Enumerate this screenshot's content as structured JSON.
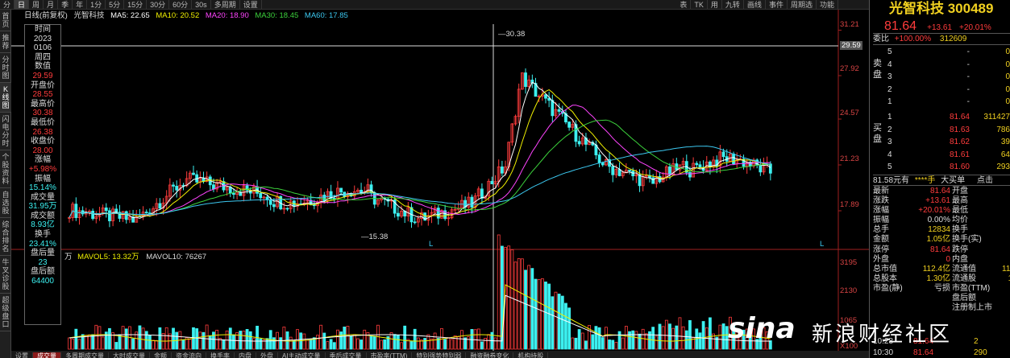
{
  "top_menu": {
    "items": [
      "分",
      "日",
      "周",
      "月",
      "季",
      "年",
      "1分",
      "5分",
      "15分",
      "30分",
      "60分",
      "30s",
      "多周期",
      "设置"
    ],
    "selected_index": 1,
    "right_items": [
      "表",
      "TK",
      "用",
      "九转",
      "画线",
      "事件",
      "周期选",
      "功能"
    ]
  },
  "left_nav": [
    {
      "label": "首页",
      "selected": false
    },
    {
      "label": "推荐",
      "selected": false
    },
    {
      "label": "分时图",
      "selected": false
    },
    {
      "label": "K线图",
      "selected": true
    },
    {
      "label": "闪电分时",
      "selected": false
    },
    {
      "label": "个股资料",
      "selected": false
    },
    {
      "label": "自选股",
      "selected": false
    },
    {
      "label": "综合排名",
      "selected": false
    },
    {
      "label": "牛叉诊股",
      "selected": false
    },
    {
      "label": "超级盘口",
      "selected": false
    }
  ],
  "chart_header": {
    "period": "日线(前复权)",
    "stock": "光智科技",
    "ma5": "MA5: 22.65",
    "ma10": "MA10: 20.52",
    "ma20": "MA20: 18.90",
    "ma30": "MA30: 18.45",
    "ma60": "MA60: 17.85",
    "colors": {
      "ma5": "#ffffff",
      "ma10": "#f0f000",
      "ma20": "#ff44ff",
      "ma30": "#3cd23c",
      "ma60": "#3cc8f0"
    }
  },
  "data_window": {
    "rows": [
      {
        "label": "时间",
        "value": "2023"
      },
      {
        "label": "",
        "value": "0106"
      },
      {
        "label": "周四",
        "value": ""
      },
      {
        "label": "数值",
        "value": "29.59",
        "color": "red"
      },
      {
        "label": "开盘价",
        "value": "28.55",
        "color": "red"
      },
      {
        "label": "最高价",
        "value": "30.38",
        "color": "red"
      },
      {
        "label": "最低价",
        "value": "26.38",
        "color": "red"
      },
      {
        "label": "收盘价",
        "value": "28.00",
        "color": "red"
      },
      {
        "label": "涨幅",
        "value": "+5.98%",
        "color": "red"
      },
      {
        "label": "振幅",
        "value": "15.14%",
        "color": "cyan"
      },
      {
        "label": "成交量",
        "value": "31.95万",
        "color": "cyan"
      },
      {
        "label": "成交额",
        "value": "8.93亿",
        "color": "cyan"
      },
      {
        "label": "换手",
        "value": "23.41%",
        "color": "cyan"
      },
      {
        "label": "盘后量",
        "value": "23",
        "color": "cyan"
      },
      {
        "label": "盘后额",
        "value": "64400",
        "color": "cyan"
      }
    ]
  },
  "price_chart": {
    "price_labels": [
      "31.21",
      "29.59",
      "27.92",
      "24.57",
      "21.23",
      "17.89"
    ],
    "high_marker": "30.38",
    "low_marker": "15.38",
    "l_markers": [
      "L",
      "L"
    ]
  },
  "volume_chart": {
    "unit": "万",
    "mavol5": "MAVOL5: 13.32万",
    "mavol10": "MAVOL10: 76267",
    "labels": [
      "3195",
      "2130",
      "1065",
      "X100"
    ]
  },
  "bottom_tabs": {
    "items": [
      "设置",
      "成交量",
      "多周期成交量",
      "大时成交量",
      "金额",
      "资金流向",
      "换手率",
      "内盘",
      "外盘",
      "AI主动成交量",
      "季后成交量",
      "市盈率(TTM)",
      "特别强势特别弱",
      "融资融券变化",
      "机构持股"
    ],
    "selected_index": 1
  },
  "quote_panel": {
    "title": "光智科技 300489",
    "price": "81.64",
    "change": "+13.61",
    "pct": "+20.01%",
    "ratio_label": "委比",
    "ratio_value": "+100.00%",
    "ratio_diff": "312609",
    "sell_label": "卖盘",
    "buy_label": "买盘",
    "sell": [
      {
        "n": "5",
        "p": "-",
        "v": "0"
      },
      {
        "n": "4",
        "p": "-",
        "v": "0"
      },
      {
        "n": "3",
        "p": "-",
        "v": "0"
      },
      {
        "n": "2",
        "p": "-",
        "v": "0"
      },
      {
        "n": "1",
        "p": "-",
        "v": "0"
      }
    ],
    "buy": [
      {
        "n": "1",
        "p": "81.64",
        "v": "311427"
      },
      {
        "n": "2",
        "p": "81.63",
        "v": "786"
      },
      {
        "n": "3",
        "p": "81.62",
        "v": "39"
      },
      {
        "n": "4",
        "p": "81.61",
        "v": "64"
      },
      {
        "n": "5",
        "p": "81.60",
        "v": "293"
      }
    ],
    "sep_text": "81.58元有",
    "sep_mid": "****手",
    "sep_big": "大买单",
    "sep_more": "点击",
    "stats": [
      {
        "k1": "最新",
        "v1": "81.64",
        "c1": "red",
        "k2": "开盘",
        "v2": "8",
        "c2": "red"
      },
      {
        "k1": "涨跌",
        "v1": "+13.61",
        "c1": "red",
        "k2": "最高",
        "v2": "8",
        "c2": "red"
      },
      {
        "k1": "涨幅",
        "v1": "+20.01%",
        "c1": "red",
        "k2": "最低",
        "v2": "6",
        "c2": "red"
      },
      {
        "k1": "振幅",
        "v1": "0.00%",
        "c1": "white",
        "k2": "均价",
        "v2": "8",
        "c2": "red"
      },
      {
        "k1": "总手",
        "v1": "12834",
        "c1": "yellow",
        "k2": "换手",
        "v2": "",
        "c2": "white"
      },
      {
        "k1": "金额",
        "v1": "1.05亿",
        "c1": "yellow",
        "k2": "换手(实)",
        "v2": "",
        "c2": "white"
      },
      {
        "k1": "涨停",
        "v1": "81.64",
        "c1": "red",
        "k2": "跌停",
        "v2": "5",
        "c2": "green"
      },
      {
        "k1": "外盘",
        "v1": "0",
        "c1": "red",
        "k2": "内盘",
        "v2": "",
        "c2": "green"
      },
      {
        "k1": "总市值",
        "v1": "112.4亿",
        "c1": "yellow",
        "k2": "流通值",
        "v2": "112",
        "c2": "yellow"
      },
      {
        "k1": "总股本",
        "v1": "1.30亿",
        "c1": "yellow",
        "k2": "流通股",
        "v2": "1.",
        "c2": "yellow"
      },
      {
        "k1": "市盈(静)",
        "v1": "亏损",
        "c1": "white",
        "k2": "市盈(TTM)",
        "v2": "",
        "c2": "white"
      },
      {
        "k1": "",
        "v1": "",
        "c1": "white",
        "k2": "盘后额",
        "v2": "",
        "c2": "white"
      },
      {
        "k1": "",
        "v1": "",
        "c1": "white",
        "k2": "注册制上市",
        "v2": "",
        "c2": "white"
      }
    ],
    "trades": [
      {
        "t": "10:28",
        "p": "81.64",
        "v": "2"
      },
      {
        "t": "10:30",
        "p": "81.64",
        "v": "290"
      }
    ]
  },
  "watermark": {
    "logo": "sina",
    "text": "新浪财经社区"
  }
}
